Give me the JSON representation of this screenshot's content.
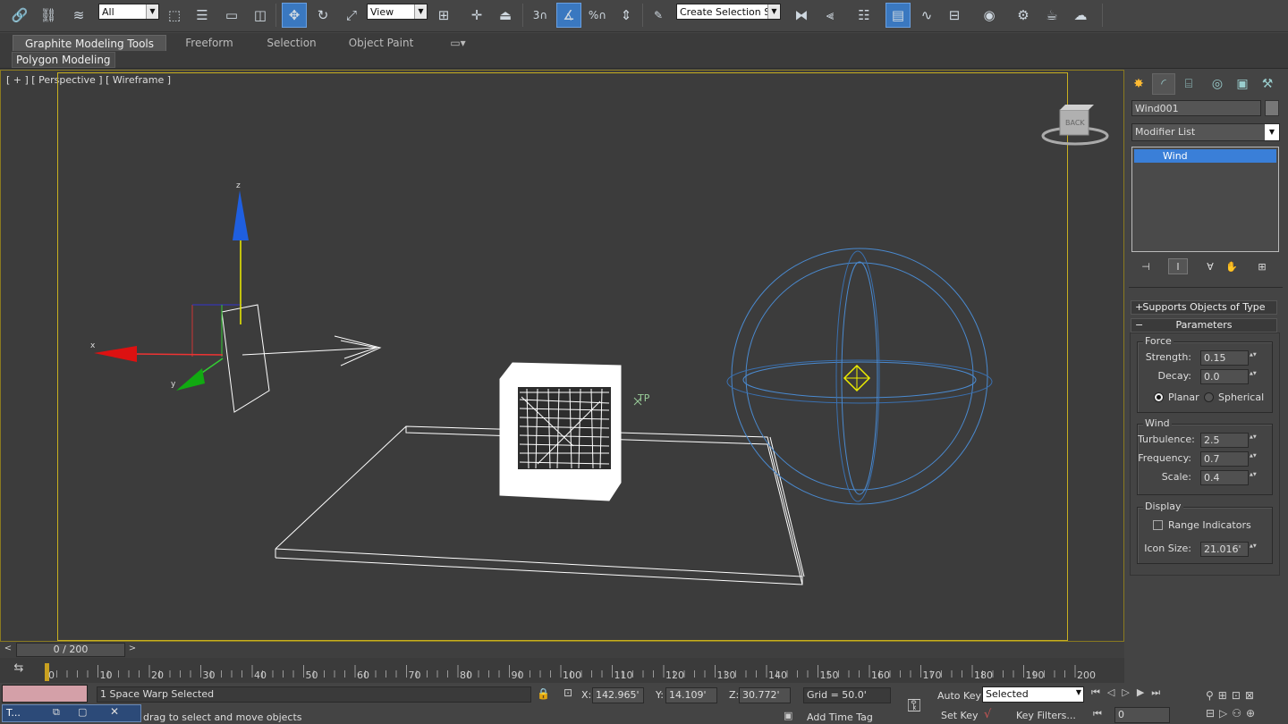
{
  "toolbar": {
    "selection_filter": "All",
    "reference_coord": "View",
    "snap_value": "3",
    "named_selection": "Create Selection Se"
  },
  "ribbon": {
    "tabs": [
      "Graphite Modeling Tools",
      "Freeform",
      "Selection",
      "Object Paint"
    ],
    "active_panel": "Polygon Modeling"
  },
  "viewport": {
    "label": "[ + ] [ Perspective ] [ Wireframe ]",
    "viewcube_face": "BACK",
    "axis_z": "z",
    "axis_x": "x",
    "axis_y": "y",
    "object_label": "TP"
  },
  "command_panel": {
    "object_name": "Wind001",
    "modifier_list": "Modifier List",
    "stack_items": [
      "Wind"
    ],
    "rollouts": {
      "supports": "Supports Objects of Type",
      "parameters": "Parameters"
    },
    "force": {
      "group": "Force",
      "strength_label": "Strength:",
      "strength": "0.15",
      "decay_label": "Decay:",
      "decay": "0.0",
      "planar": "Planar",
      "spherical": "Spherical"
    },
    "wind": {
      "group": "Wind",
      "turbulence_label": "Turbulence:",
      "turbulence": "2.5",
      "frequency_label": "Frequency:",
      "frequency": "0.7",
      "scale_label": "Scale:",
      "scale": "0.4"
    },
    "display": {
      "group": "Display",
      "range_indicators": "Range Indicators",
      "icon_size_label": "Icon Size:",
      "icon_size": "21.016'"
    }
  },
  "timeline": {
    "slider": "0 / 200",
    "ticks": [
      "0",
      "10",
      "20",
      "30",
      "40",
      "50",
      "60",
      "70",
      "80",
      "90",
      "100",
      "110",
      "120",
      "130",
      "140",
      "150",
      "160",
      "170",
      "180",
      "190",
      "200"
    ]
  },
  "status": {
    "selection_info": "1 Space Warp Selected",
    "prompt": "drag to select and move objects",
    "x_label": "X:",
    "x": "142.965'",
    "y_label": "Y:",
    "y": "14.109'",
    "z_label": "Z:",
    "z": "30.772'",
    "grid": "Grid = 50.0'",
    "add_time_tag": "Add Time Tag",
    "auto_key": "Auto Key",
    "set_key": "Set Key",
    "key_mode": "Selected",
    "key_filters": "Key Filters...",
    "frame": "0",
    "maxscript_tab": "T..."
  }
}
